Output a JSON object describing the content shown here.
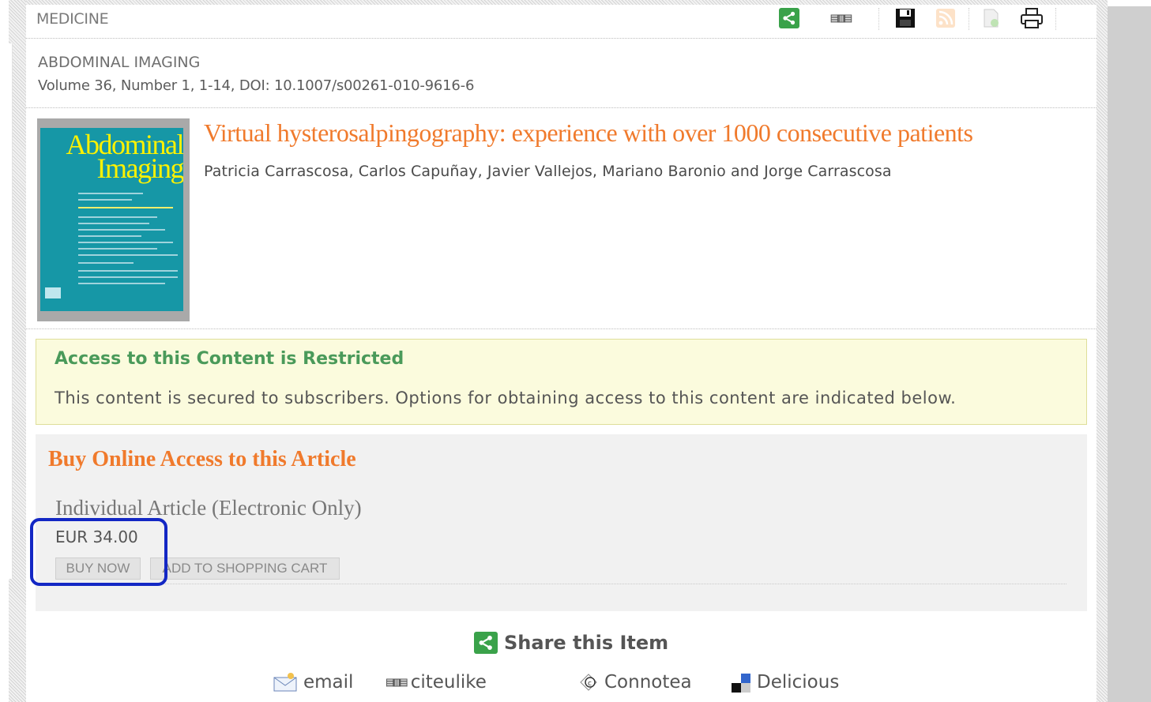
{
  "header": {
    "subject": "MEDICINE",
    "toolbar": [
      "share-icon",
      "bookmark-icon",
      "save-icon",
      "rss-feed-icon",
      "export-citation-icon",
      "print-icon"
    ]
  },
  "journal": {
    "name": "ABDOMINAL IMAGING",
    "citation": "Volume 36, Number 1, 1-14, DOI: 10.1007/s00261-010-9616-6",
    "cover_title": "Abdominal Imaging"
  },
  "article": {
    "title": "Virtual hysterosalpingography: experience with over 1000 consecutive patients",
    "authors": "Patricia Carrascosa, Carlos Capuñay, Javier Vallejos, Mariano Baronio and Jorge Carrascosa"
  },
  "restricted": {
    "title": "Access to this Content is Restricted",
    "text": "This content is secured to subscribers. Options for obtaining access to this content are indicated below."
  },
  "purchase": {
    "heading": "Buy Online Access to this Article",
    "product": "Individual Article (Electronic Only)",
    "price": "EUR 34.00",
    "buy_now": "BUY NOW",
    "add_to_cart": "ADD TO SHOPPING CART"
  },
  "share": {
    "heading": "Share this Item",
    "links": [
      {
        "label": "email",
        "icon": "email-icon"
      },
      {
        "label": "citeulike",
        "icon": "citeulike-icon"
      },
      {
        "label": "Connotea",
        "icon": "connotea-icon"
      },
      {
        "label": "Delicious",
        "icon": "delicious-icon"
      }
    ]
  },
  "colors": {
    "accent_orange": "#f07a2c",
    "share_green": "#3aa24a",
    "restricted_green": "#4a9a5a",
    "restricted_bg": "#fbfbdd",
    "highlight_blue": "#1327c4"
  }
}
